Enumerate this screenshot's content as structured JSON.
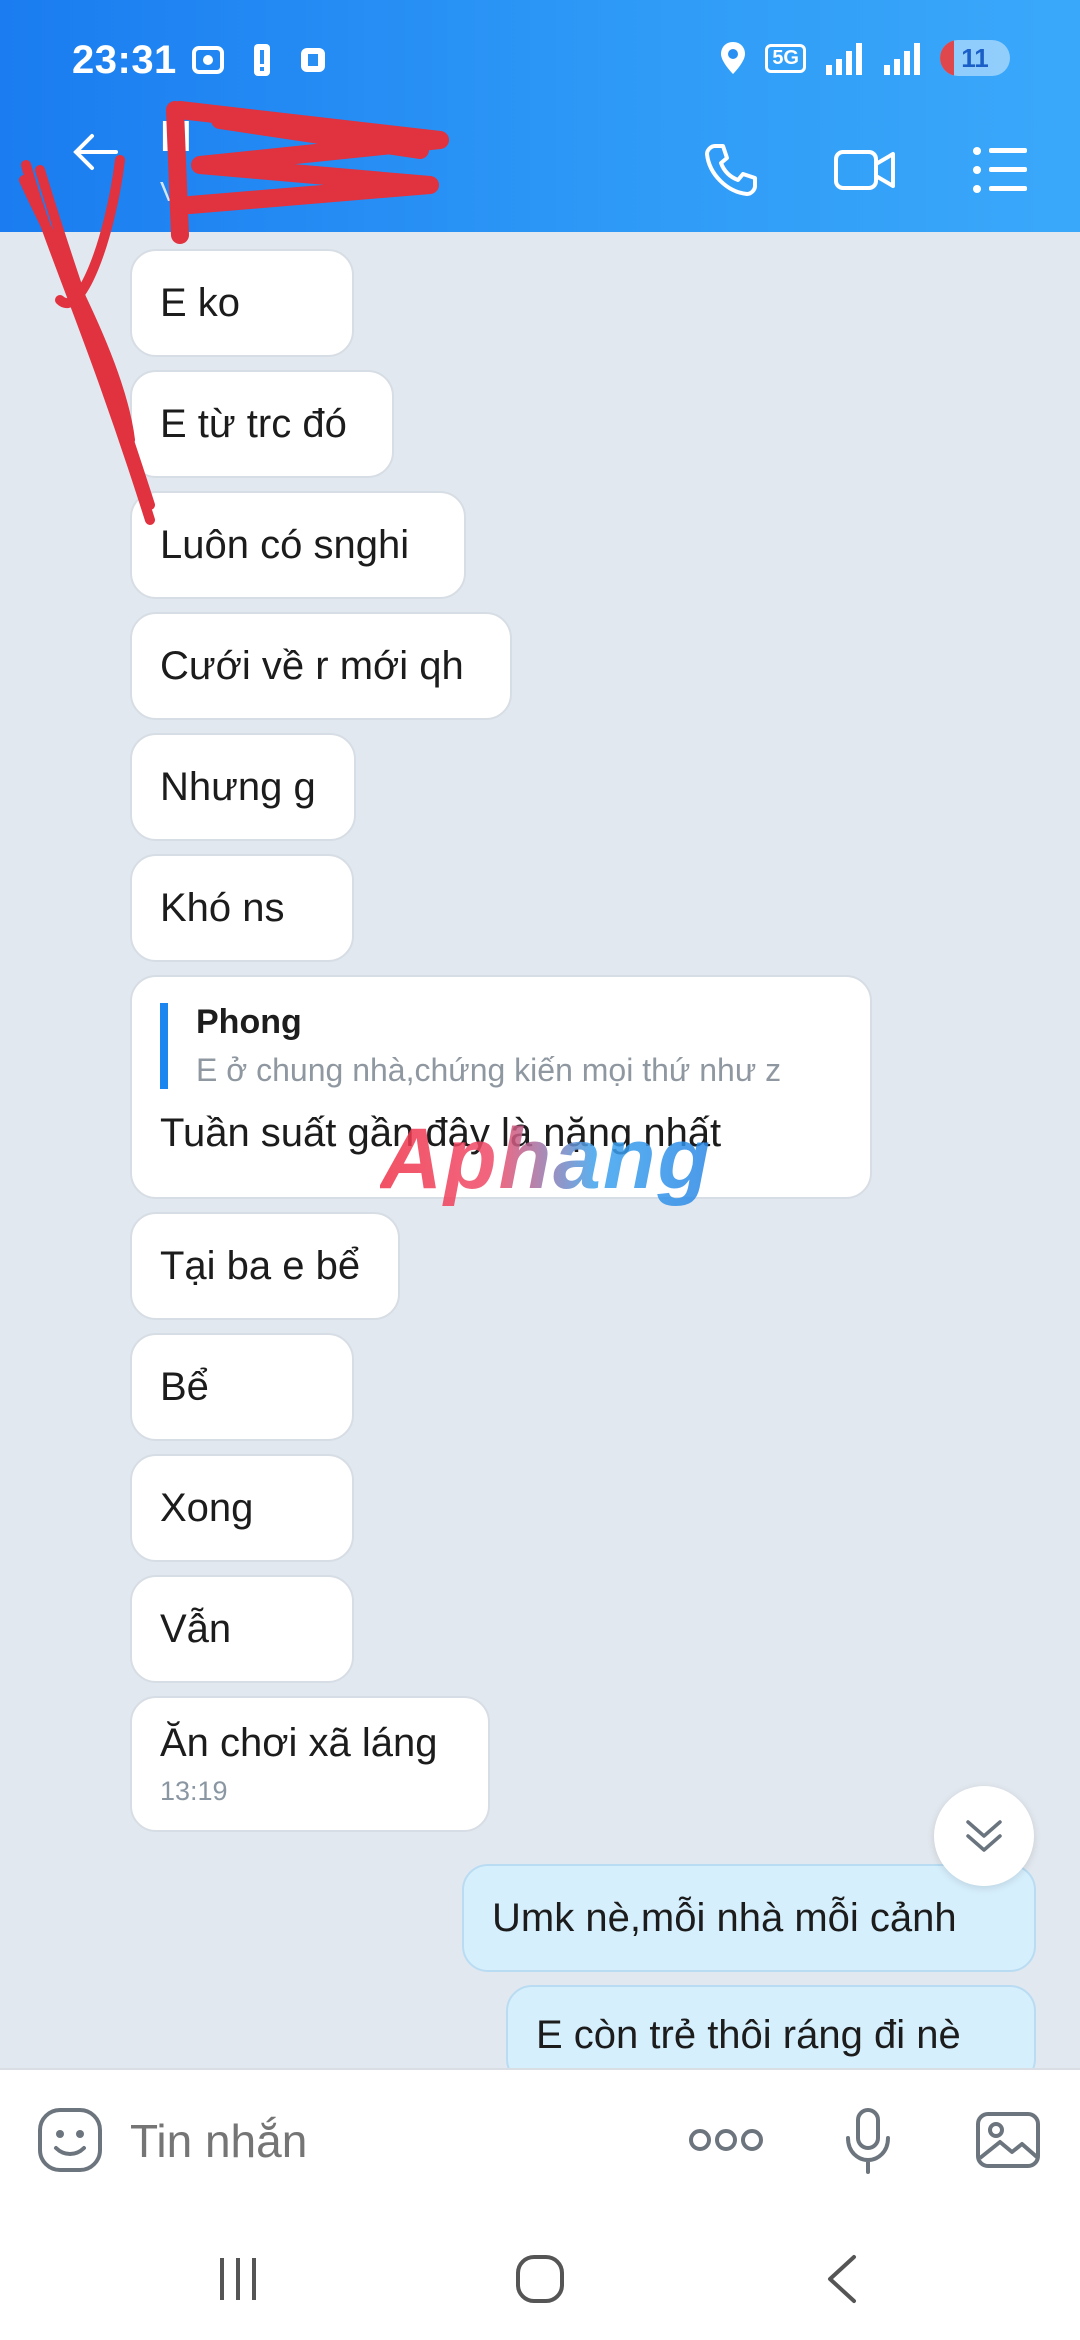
{
  "status_bar": {
    "time": "23:31",
    "network": "5G",
    "battery": "11"
  },
  "header": {
    "title": "H",
    "subtitle": "V",
    "icons": [
      "back-arrow-icon",
      "phone-icon",
      "video-camera-icon",
      "menu-list-icon"
    ]
  },
  "messages": [
    {
      "text": "E ko",
      "dir": "in"
    },
    {
      "text": "E từ trc đó",
      "dir": "in"
    },
    {
      "text": "Luôn có snghi",
      "dir": "in"
    },
    {
      "text": "Cưới về r mới qh",
      "dir": "in"
    },
    {
      "text": "Nhưng g",
      "dir": "in"
    },
    {
      "text": "Khó ns",
      "dir": "in"
    },
    {
      "text": "Tuần suất gần đây là nặng nhất",
      "dir": "in",
      "quote": {
        "name": "Phong",
        "text": "E ở chung nhà,chứng kiến mọi thứ như z"
      }
    },
    {
      "text": "Tại ba e bể",
      "dir": "in"
    },
    {
      "text": "Bể",
      "dir": "in"
    },
    {
      "text": "Xong",
      "dir": "in"
    },
    {
      "text": "Vẫn",
      "dir": "in"
    },
    {
      "text": "Ăn chơi xã láng",
      "dir": "in",
      "time": "13:19"
    },
    {
      "text": "Umk nè,mỗi nhà mỗi cảnh",
      "dir": "out"
    },
    {
      "text": "E còn trẻ thôi ráng đi nè",
      "dir": "out"
    }
  ],
  "watermark": "Aphang",
  "composer": {
    "placeholder": "Tin nhắn",
    "icons": [
      "sticker-icon",
      "more-dots-icon",
      "microphone-icon",
      "image-icon"
    ]
  },
  "colors": {
    "header_start": "#1a7cf0",
    "header_end": "#3aa8fa",
    "background": "#e2e8ef",
    "outgoing_bubble": "#d6effd",
    "quote_bar": "#1b86ef",
    "redaction": "#e0323f"
  }
}
